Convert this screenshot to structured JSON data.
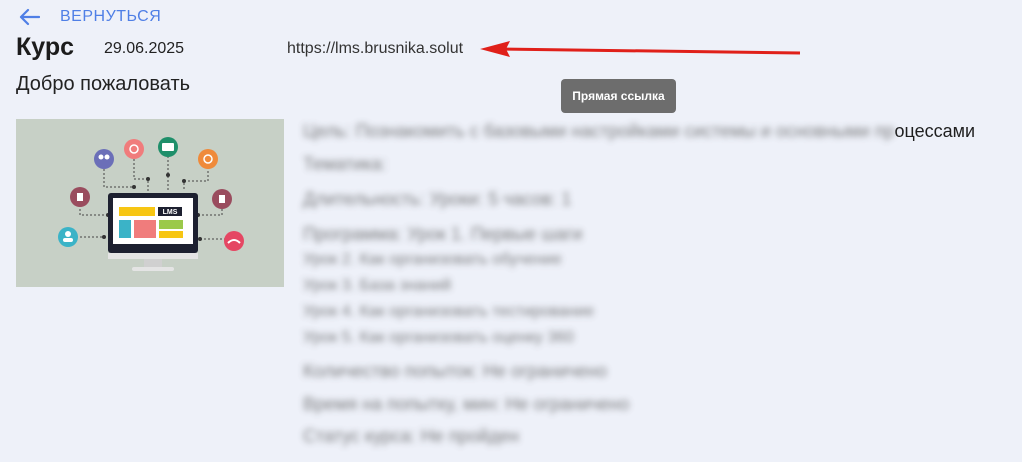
{
  "back": {
    "label": "ВЕРНУТЬСЯ"
  },
  "course": {
    "title": "Курс",
    "date": "29.06.2025",
    "link": "https://lms.brusnika.solutions",
    "welcome": "Добро пожаловать"
  },
  "tooltip": {
    "text": "Прямая ссылка"
  },
  "thumbnail": {
    "badge": "LMS"
  },
  "description": {
    "line1_blurred": "Цель: Познакомить с базовыми настройками системы и основными пр",
    "line1_visible": "оцессами",
    "lines": [
      "Тематика:",
      "Длительность: Уроки: 5 часов: 1",
      "Программа: Урок 1. Первые шаги",
      "Урок 2. Как организовать обучение",
      "Урок 3. База знаний",
      "Урок 4. Как организовать тестирование",
      "Урок 5. Как организовать оценку 360",
      "Количество попыток: Не ограничено",
      "Время на попытку, мин: Не ограничено",
      "Статус курса: Не пройден"
    ]
  },
  "colors": {
    "accent": "#4f7fe6",
    "background": "#eef1f9",
    "annotation_arrow": "#e0201a",
    "tooltip_bg": "#6d6d6d"
  }
}
